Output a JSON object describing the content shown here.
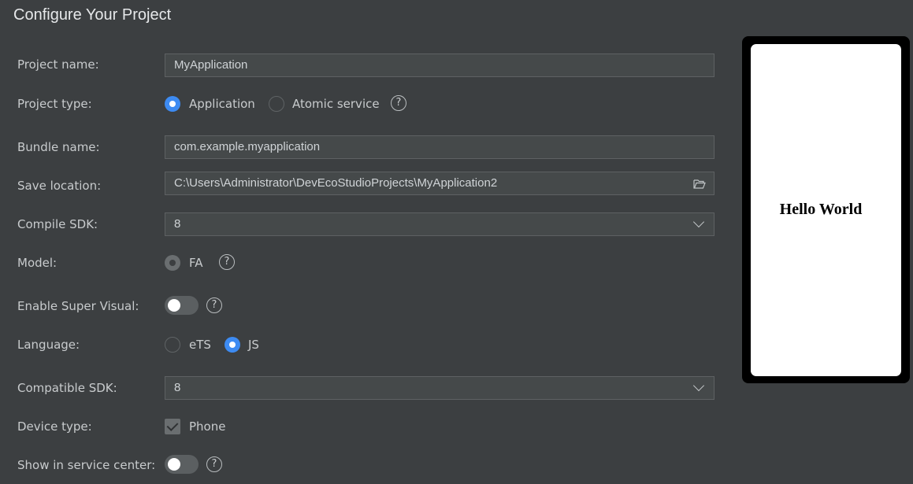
{
  "title": "Configure Your Project",
  "project_name": {
    "label": "Project name:",
    "value": "MyApplication"
  },
  "project_type": {
    "label": "Project type:",
    "options": [
      "Application",
      "Atomic service"
    ],
    "selected": "Application",
    "help": "?"
  },
  "bundle_name": {
    "label": "Bundle name:",
    "value": "com.example.myapplication"
  },
  "save_location": {
    "label": "Save location:",
    "value": "C:\\Users\\Administrator\\DevEcoStudioProjects\\MyApplication2",
    "icon": "folder-icon"
  },
  "compile_sdk": {
    "label": "Compile SDK:",
    "value": "8"
  },
  "model": {
    "label": "Model:",
    "option": "FA",
    "selected": "FA",
    "help": "?"
  },
  "super_visual": {
    "label": "Enable Super Visual:",
    "enabled": false,
    "help": "?"
  },
  "language": {
    "label": "Language:",
    "options": [
      "eTS",
      "JS"
    ],
    "selected": "JS"
  },
  "compatible_sdk": {
    "label": "Compatible SDK:",
    "value": "8"
  },
  "device_type": {
    "label": "Device type:",
    "option": "Phone",
    "checked": true
  },
  "service_center": {
    "label": "Show in service center:",
    "enabled": false,
    "help": "?"
  },
  "preview": {
    "text": "Hello World"
  },
  "colors": {
    "accent": "#3d8bf2",
    "background": "#3c3f41",
    "field": "#45494a"
  }
}
